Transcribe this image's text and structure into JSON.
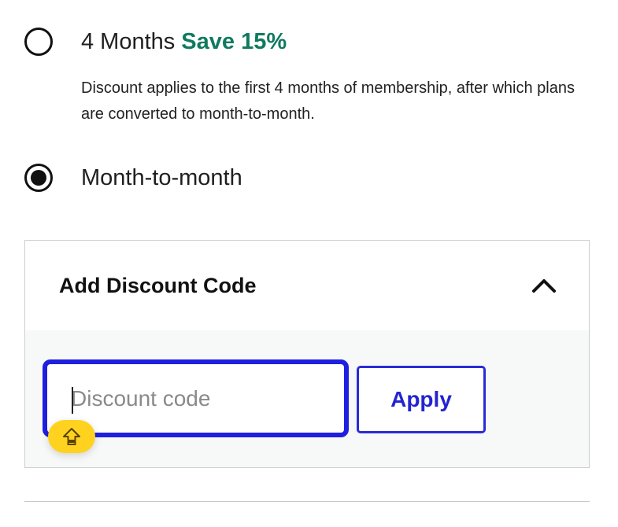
{
  "plans": {
    "four_months": {
      "label": "4 Months",
      "badge": "Save 15%",
      "selected": false,
      "description": "Discount applies to the first 4 months of membership, after which plans are converted to month-to-month."
    },
    "month_to_month": {
      "label": "Month-to-month",
      "selected": true
    }
  },
  "discount": {
    "title": "Add Discount Code",
    "expanded": true,
    "input_placeholder": "Discount code",
    "input_value": "",
    "apply_label": "Apply"
  },
  "icons": {
    "collapse": "chevron-up-icon",
    "caps_lock": "caps-lock-icon"
  },
  "colors": {
    "save_green": "#0f7a5f",
    "focus_blue": "#1f1fe0",
    "apply_blue": "#2323d2",
    "caps_badge_yellow": "#ffd21f"
  }
}
